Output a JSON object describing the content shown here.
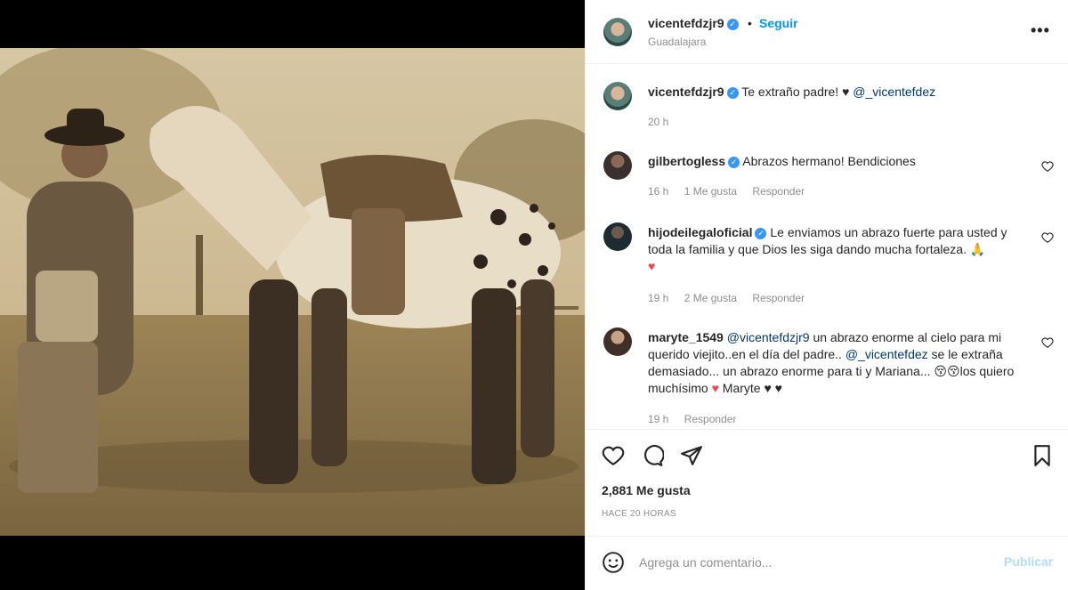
{
  "post": {
    "username": "vicentefdzjr9",
    "separator": "•",
    "follow_label": "Seguir",
    "location": "Guadalajara",
    "more_label": "•••"
  },
  "caption": {
    "username": "vicentefdzjr9",
    "text": "Te extraño padre! ♥",
    "mention": "@_vicentefdez",
    "time": "20 h"
  },
  "comments": [
    {
      "username": "gilbertogless",
      "text": "Abrazos hermano! Bendiciones",
      "time": "16 h",
      "likes": "1 Me gusta",
      "reply": "Responder"
    },
    {
      "username": "hijodeilegaloficial",
      "text": "Le enviamos un abrazo fuerte para usted y toda la familia y que Dios les siga dando mucha fortaleza. 🙏",
      "emoji": "♥",
      "time": "19 h",
      "likes": "2 Me gusta",
      "reply": "Responder"
    },
    {
      "username": "maryte_1549",
      "mention1": "@vicentefdzjr9",
      "text1": "un abrazo enorme al cielo para mi querido viejito..en el día del padre..",
      "mention2": "@_vicentefdez",
      "text2": "se le extraña demasiado... un abrazo enorme para ti y Mariana... 😚😚los quiero muchísimo",
      "heart": "♥",
      "sign": "Maryte ♥ ♥",
      "time": "19 h",
      "reply": "Responder"
    }
  ],
  "stats": {
    "likes": "2,881 Me gusta",
    "when": "HACE 20 HORAS"
  },
  "composer": {
    "placeholder": "Agrega un comentario...",
    "publish_label": "Publicar"
  },
  "icons": {
    "heart": "heart-icon",
    "comment": "comment-icon",
    "share": "share-icon",
    "save": "bookmark-icon",
    "emoji": "emoji-icon",
    "more": "more-options-icon"
  },
  "colors": {
    "link_blue": "#0095f6",
    "mention": "#00376b",
    "verified": "#3897f0",
    "muted": "#8e8e8e",
    "like_red": "#ed4956",
    "publish_disabled": "#b3dbff"
  }
}
